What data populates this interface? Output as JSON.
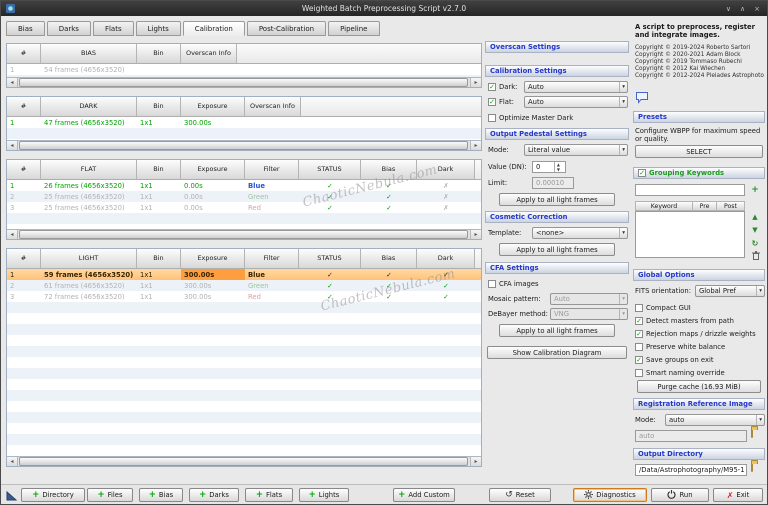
{
  "window": {
    "title": "Weighted Batch Preprocessing Script v2.7.0"
  },
  "icons": {
    "min": "∨",
    "max": "∧",
    "close": "×",
    "dropdown_arrow": "▾",
    "scroll_left": "◂",
    "scroll_right": "▸",
    "check": "✓",
    "plus": "+",
    "reset": "↺",
    "exit_x": "✗",
    "move_up": "▲",
    "move_down": "▼",
    "refresh": "↻",
    "spin_up": "▲",
    "spin_down": "▼"
  },
  "tabs": {
    "items": [
      {
        "label": "Bias"
      },
      {
        "label": "Darks"
      },
      {
        "label": "Flats"
      },
      {
        "label": "Lights"
      },
      {
        "label": "Calibration"
      },
      {
        "label": "Post-Calibration"
      },
      {
        "label": "Pipeline"
      }
    ]
  },
  "watermark": "ChaoticNebula.com",
  "bias_table": {
    "headers": {
      "num": "#",
      "type": "BIAS",
      "bin": "Bin",
      "overscan": "Overscan Info"
    },
    "rows": [
      {
        "num": "1",
        "frames": "54 frames (4656x3520)"
      }
    ]
  },
  "dark_table": {
    "headers": {
      "num": "#",
      "type": "DARK",
      "bin": "Bin",
      "exposure": "Exposure",
      "overscan": "Overscan Info"
    },
    "rows": [
      {
        "num": "1",
        "frames": "47 frames (4656x3520)",
        "bin": "1x1",
        "exposure": "300.00s"
      }
    ]
  },
  "flat_table": {
    "headers": {
      "num": "#",
      "type": "FLAT",
      "bin": "Bin",
      "exposure": "Exposure",
      "filter": "Filter",
      "status": "STATUS",
      "bias": "Bias",
      "dark": "Dark"
    },
    "rows": [
      {
        "num": "1",
        "frames": "26 frames (4656x3520)",
        "bin": "1x1",
        "exposure": "0.00s",
        "filter": "Blue",
        "status": "✓",
        "bias": "✓",
        "dark": "✗"
      },
      {
        "num": "2",
        "frames": "25 frames (4656x3520)",
        "bin": "1x1",
        "exposure": "0.00s",
        "filter": "Green",
        "status": "✓",
        "bias": "✓",
        "dark": "✗"
      },
      {
        "num": "3",
        "frames": "25 frames (4656x3520)",
        "bin": "1x1",
        "exposure": "0.00s",
        "filter": "Red",
        "status": "✓",
        "bias": "✓",
        "dark": "✗"
      }
    ]
  },
  "light_table": {
    "headers": {
      "num": "#",
      "type": "LIGHT",
      "bin": "Bin",
      "exposure": "Exposure",
      "filter": "Filter",
      "status": "STATUS",
      "bias": "Bias",
      "dark": "Dark"
    },
    "rows": [
      {
        "num": "1",
        "frames": "59 frames (4656x3520)",
        "bin": "1x1",
        "exposure": "300.00s",
        "filter": "Blue",
        "status": "✓",
        "bias": "✓",
        "dark": "✓"
      },
      {
        "num": "2",
        "frames": "61 frames (4656x3520)",
        "bin": "1x1",
        "exposure": "300.00s",
        "filter": "Green",
        "status": "✓",
        "bias": "✓",
        "dark": "✓"
      },
      {
        "num": "3",
        "frames": "72 frames (4656x3520)",
        "bin": "1x1",
        "exposure": "300.00s",
        "filter": "Red",
        "status": "✓",
        "bias": "✓",
        "dark": "✓"
      }
    ]
  },
  "overscan": {
    "title": "Overscan Settings"
  },
  "calibration": {
    "title": "Calibration Settings",
    "dark_label": "Dark:",
    "dark_value": "Auto",
    "flat_label": "Flat:",
    "flat_value": "Auto",
    "optimize_label": "Optimize Master Dark"
  },
  "pedestal": {
    "title": "Output Pedestal Settings",
    "mode_label": "Mode:",
    "mode_value": "Literal value",
    "value_label": "Value (DN):",
    "value": "0",
    "limit_label": "Limit:",
    "limit_value": "0.00010",
    "apply_label": "Apply to all light frames"
  },
  "cosmetic": {
    "title": "Cosmetic Correction",
    "template_label": "Template:",
    "template_value": "<none>",
    "apply_label": "Apply to all light frames"
  },
  "cfa": {
    "title": "CFA Settings",
    "cfa_label": "CFA images",
    "mosaic_label": "Mosaic pattern:",
    "mosaic_value": "Auto",
    "debayer_label": "DeBayer method:",
    "debayer_value": "VNG",
    "apply_label": "Apply to all light frames"
  },
  "diagram_button_label": "Show Calibration Diagram",
  "about": {
    "description": "A script to preprocess, register and integrate images.",
    "copyrights": [
      "Copyright © 2019-2024 Roberto Sartori",
      "Copyright © 2020-2021 Adam Block",
      "Copyright © 2019 Tommaso Rubechi",
      "Copyright © 2012 Kai Wiechen",
      "Copyright © 2012-2024 Pleiades Astrophoto"
    ]
  },
  "presets": {
    "title": "Presets",
    "description": "Configure WBPP for maximum speed or quality.",
    "select_label": "SELECT"
  },
  "grouping": {
    "title": "Grouping Keywords",
    "input_value": "",
    "columns": {
      "keyword": "Keyword",
      "pre": "Pre",
      "post": "Post"
    }
  },
  "global_options": {
    "title": "Global Options",
    "fits_label": "FITS orientation:",
    "fits_value": "Global Pref",
    "checkboxes": [
      {
        "label": "Compact GUI",
        "checked": false
      },
      {
        "label": "Detect masters from path",
        "checked": true
      },
      {
        "label": "Rejection maps / drizzle weights",
        "checked": true
      },
      {
        "label": "Preserve white balance",
        "checked": false
      },
      {
        "label": "Save groups on exit",
        "checked": true
      },
      {
        "label": "Smart naming override",
        "checked": false
      }
    ],
    "purge_label": "Purge cache (16.93 MiB)"
  },
  "registration": {
    "title": "Registration Reference Image",
    "mode_label": "Mode:",
    "mode_value": "auto",
    "path_value": "auto"
  },
  "output_dir": {
    "title": "Output Directory",
    "path": "/Data/Astrophotography/M95-1"
  },
  "toolbar": {
    "buttons": [
      {
        "label": "Directory"
      },
      {
        "label": "Files"
      },
      {
        "label": "Bias"
      },
      {
        "label": "Darks"
      },
      {
        "label": "Flats"
      },
      {
        "label": "Lights"
      },
      {
        "label": "Add Custom"
      },
      {
        "label": "Reset"
      },
      {
        "label": "Diagnostics"
      },
      {
        "label": "Run"
      },
      {
        "label": "Exit"
      }
    ]
  }
}
